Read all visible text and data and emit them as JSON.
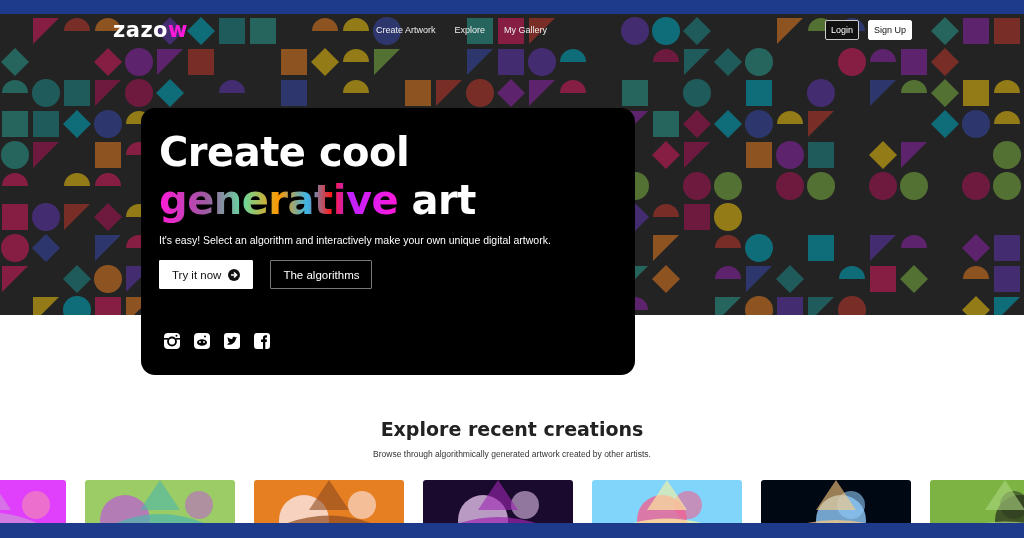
{
  "nav": {
    "logo": {
      "text": "zazo",
      "accent": "w"
    },
    "links": [
      {
        "label": "Create Artwork"
      },
      {
        "label": "Explore"
      },
      {
        "label": "My Gallery"
      }
    ],
    "auth": [
      {
        "label": "Login",
        "kind": "outline"
      },
      {
        "label": "Sign Up",
        "kind": "solid"
      }
    ]
  },
  "hero": {
    "title_line": "Create cool",
    "highlight": "generative",
    "title_rest": "art",
    "text": "It's easy! Select an algorithm and interactively make your own unique digital artwork.",
    "buttons": [
      {
        "label": "Try it now",
        "kind": "solid"
      },
      {
        "label": "The algorithms",
        "kind": "outline"
      }
    ],
    "social": [
      {
        "kind": "instagram"
      },
      {
        "kind": "reddit"
      },
      {
        "kind": "twitter"
      },
      {
        "kind": "facebook"
      }
    ]
  },
  "explore": {
    "title": "Explore recent creations",
    "subtitle": "Browse through algorithmically generated artwork created by other artists."
  }
}
